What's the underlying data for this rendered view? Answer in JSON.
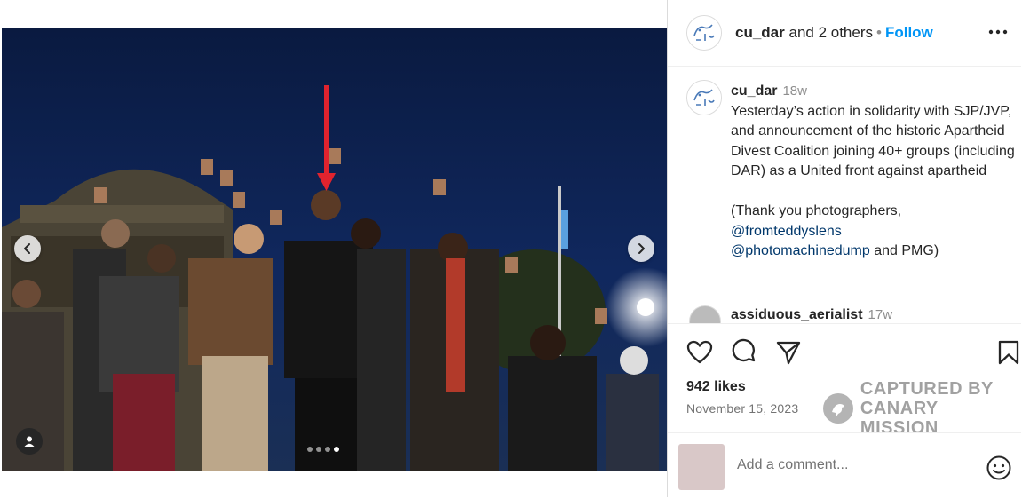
{
  "post": {
    "carousel": {
      "slides": 4,
      "active_slide": 4
    }
  },
  "header": {
    "username": "cu_dar",
    "coauthors": "and 2 others",
    "separator": "•",
    "follow_label": "Follow"
  },
  "caption": {
    "username": "cu_dar",
    "time": "18w",
    "text": "Yesterday’s action in solidarity with SJP/JVP, and announcement of the historic Apartheid Divest Coalition joining 40+ groups (including DAR) as a United front against apartheid\n\n(Thank you photographers,",
    "mention1": "@fromteddyslens",
    "mention2": "@photomachinedump",
    "tail": " and PMG)"
  },
  "comment_preview": {
    "username": "assiduous_aerialist",
    "time": "17w"
  },
  "stats": {
    "likes": "942 likes",
    "date": "November 15, 2023"
  },
  "watermark": {
    "line1": "CAPTURED BY",
    "line2": "CANARY MISSION"
  },
  "comment_box": {
    "placeholder": "Add a comment..."
  },
  "icons": {
    "header_more": "more-horizontal-icon",
    "like": "heart-icon",
    "comment": "comment-icon",
    "share": "share-icon",
    "save": "bookmark-icon",
    "emoji": "emoji-icon",
    "prev": "chevron-left-icon",
    "next": "chevron-right-icon",
    "tag": "user-tag-icon"
  },
  "colors": {
    "link": "#0095f6",
    "mention": "#00376b",
    "arrow": "#e0232e",
    "sky": "#0b1d45"
  }
}
